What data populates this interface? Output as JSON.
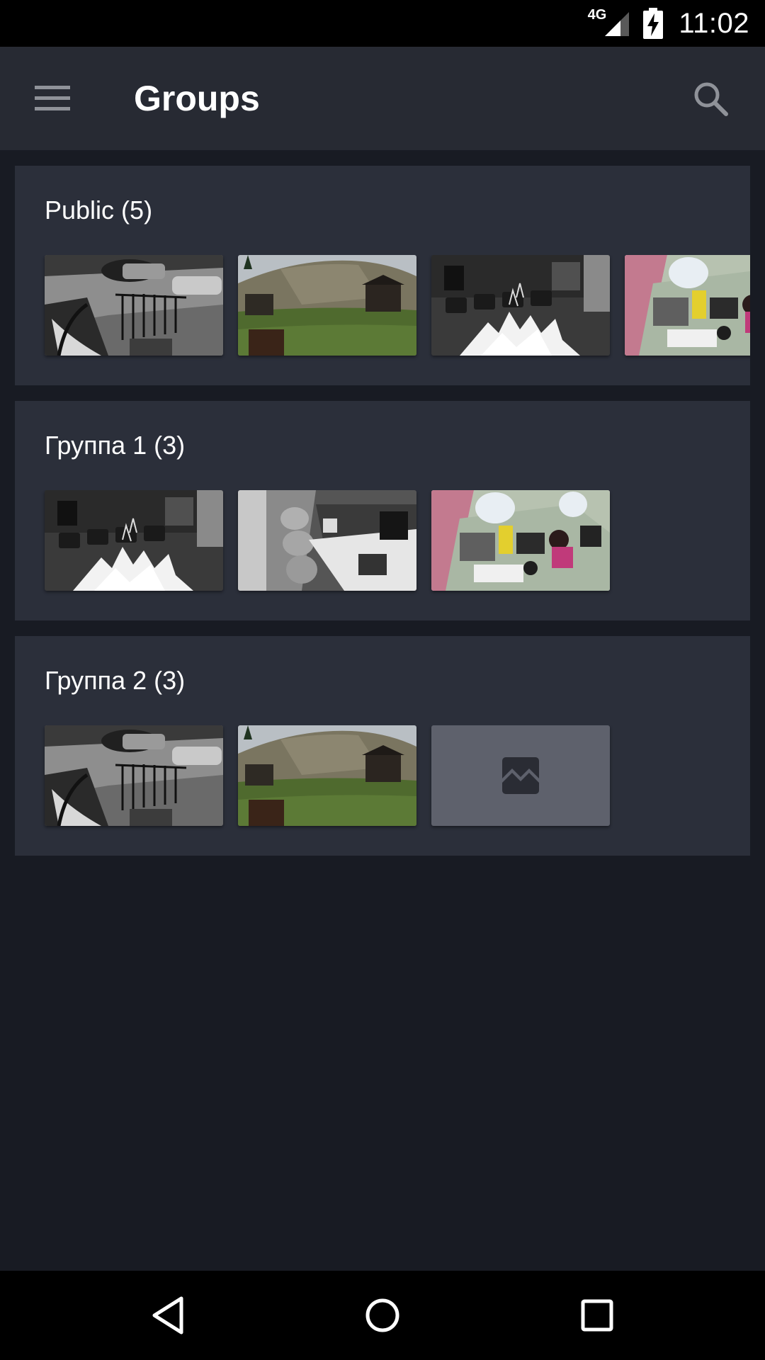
{
  "status_bar": {
    "network_label": "4G",
    "time": "11:02",
    "icons": [
      "signal-icon",
      "battery-charging-icon"
    ]
  },
  "app_bar": {
    "title": "Groups",
    "menu_icon": "hamburger-menu-icon",
    "search_icon": "search-icon"
  },
  "groups": [
    {
      "title": "Public (5)",
      "thumbnails": [
        "street-night-camera",
        "mountain-hillside-camera",
        "office-night-camera",
        "salon-color-camera"
      ]
    },
    {
      "title": "Группа 1 (3)",
      "thumbnails": [
        "office-night-camera",
        "store-night-camera",
        "salon-color-camera"
      ]
    },
    {
      "title": "Группа 2 (3)",
      "thumbnails": [
        "street-night-camera",
        "mountain-hillside-camera",
        "image-placeholder-icon"
      ]
    }
  ],
  "nav_bar": {
    "icons": [
      "back-icon",
      "home-icon",
      "recents-icon"
    ]
  },
  "colors": {
    "background": "#181b23",
    "app_bar": "#272a33",
    "card": "#2b2f3a",
    "placeholder": "#5e616c",
    "system_bars": "#000000"
  }
}
